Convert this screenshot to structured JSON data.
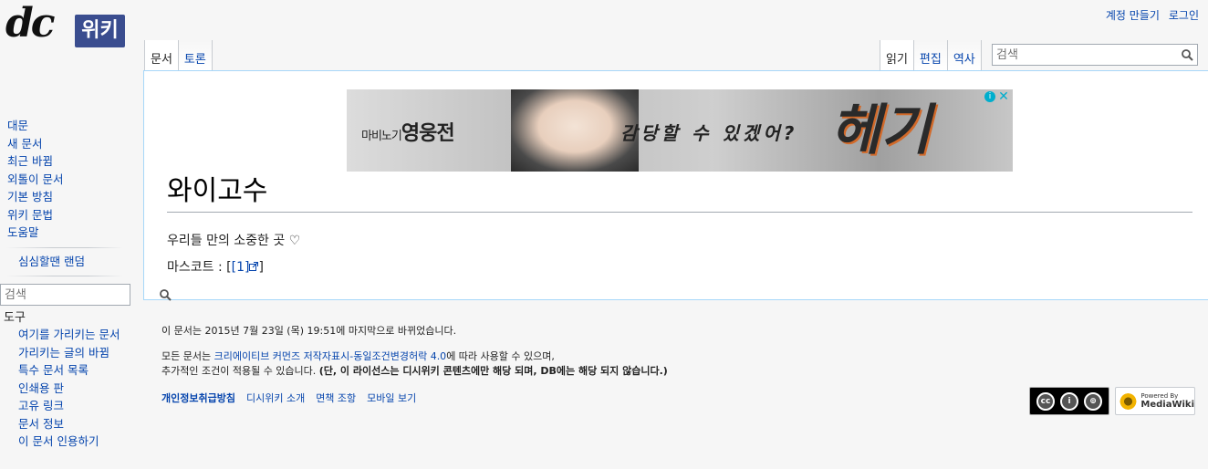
{
  "logo": {
    "dc": "dc",
    "wiki": "위키"
  },
  "personal": {
    "create_account": "계정 만들기",
    "login": "로그인"
  },
  "tabs_left": [
    "문서",
    "토론"
  ],
  "tabs_right": [
    "읽기",
    "편집",
    "역사"
  ],
  "search": {
    "placeholder": "검색"
  },
  "ad": {
    "brand_small": "마비노기",
    "brand": "영웅전",
    "line": "감당할 수 있겠어?",
    "logo": "헤기"
  },
  "page": {
    "title": "와이고수",
    "line1": "우리들 만의 소중한 곳 ♡",
    "mascot_prefix": "마스코트 : [",
    "mascot_link": "[1]",
    "mascot_suffix": "]"
  },
  "sidebar": {
    "nav": [
      "대문",
      "새 문서",
      "최근 바뀜",
      "외톨이 문서",
      "기본 방침",
      "위키 문법",
      "도움말"
    ],
    "random": "심심할땐 랜덤",
    "tools_title": "도구",
    "tools": [
      "여기를 가리키는 문서",
      "가리키는 글의 바뀜",
      "특수 문서 목록",
      "인쇄용 판",
      "고유 링크",
      "문서 정보",
      "이 문서 인용하기"
    ]
  },
  "footer": {
    "last_modified": "이 문서는 2015년 7월 23일 (목) 19:51에 마지막으로 바뀌었습니다.",
    "license_prefix": "모든 문서는 ",
    "license_link": "크리에이티브 커먼즈 저작자표시-동일조건변경허락 4.0",
    "license_suffix": "에 따라 사용할 수 있으며,",
    "license_line2": "추가적인 조건이 적용될 수 있습니다. ",
    "license_bold": "(단, 이 라이선스는 디시위키 콘텐츠에만 해당 되며, DB에는 해당 되지 않습니다.)",
    "links": [
      "개인정보취급방침",
      "디시위키 소개",
      "면책 조항",
      "모바일 보기"
    ],
    "cc_badge": [
      "cc",
      "i",
      "⊚"
    ],
    "mw_badge_small": "Powered By",
    "mw_badge": "MediaWiki"
  }
}
